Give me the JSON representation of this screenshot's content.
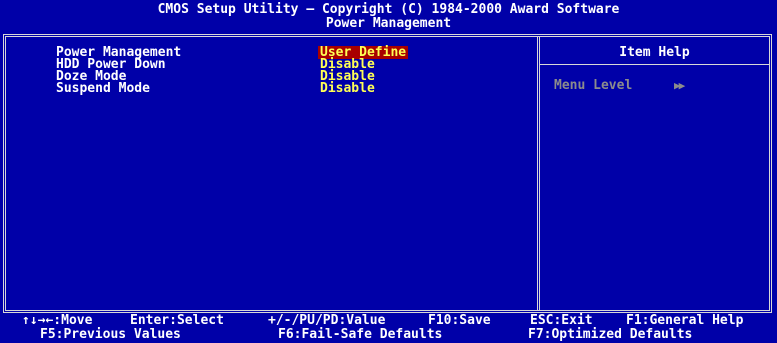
{
  "header": {
    "title": "CMOS Setup Utility – Copyright (C) 1984-2000 Award Software",
    "subtitle": "Power Management"
  },
  "settings": [
    {
      "label": "Power Management",
      "value": "User Define",
      "selected": true
    },
    {
      "label": "HDD Power Down",
      "value": "Disable",
      "selected": false
    },
    {
      "label": "Doze Mode",
      "value": "Disable",
      "selected": false
    },
    {
      "label": "Suspend Mode",
      "value": "Disable",
      "selected": false
    }
  ],
  "help_panel": {
    "title": "Item Help",
    "menu_level_label": "Menu Level",
    "menu_level_arrows": "▶▶"
  },
  "footer": {
    "row1": [
      "↑↓→←:Move",
      "Enter:Select",
      "+/-/PU/PD:Value",
      "F10:Save",
      "ESC:Exit",
      "F1:General Help"
    ],
    "row2": [
      "F5:Previous Values",
      "F6:Fail-Safe Defaults",
      "F7:Optimized Defaults"
    ]
  },
  "colors": {
    "background": "#0000a8",
    "text": "#ffffff",
    "value": "#ffff54",
    "selected_background": "#a80000",
    "disabled_text": "#8c8c8c",
    "border": "#d8d8d8"
  }
}
